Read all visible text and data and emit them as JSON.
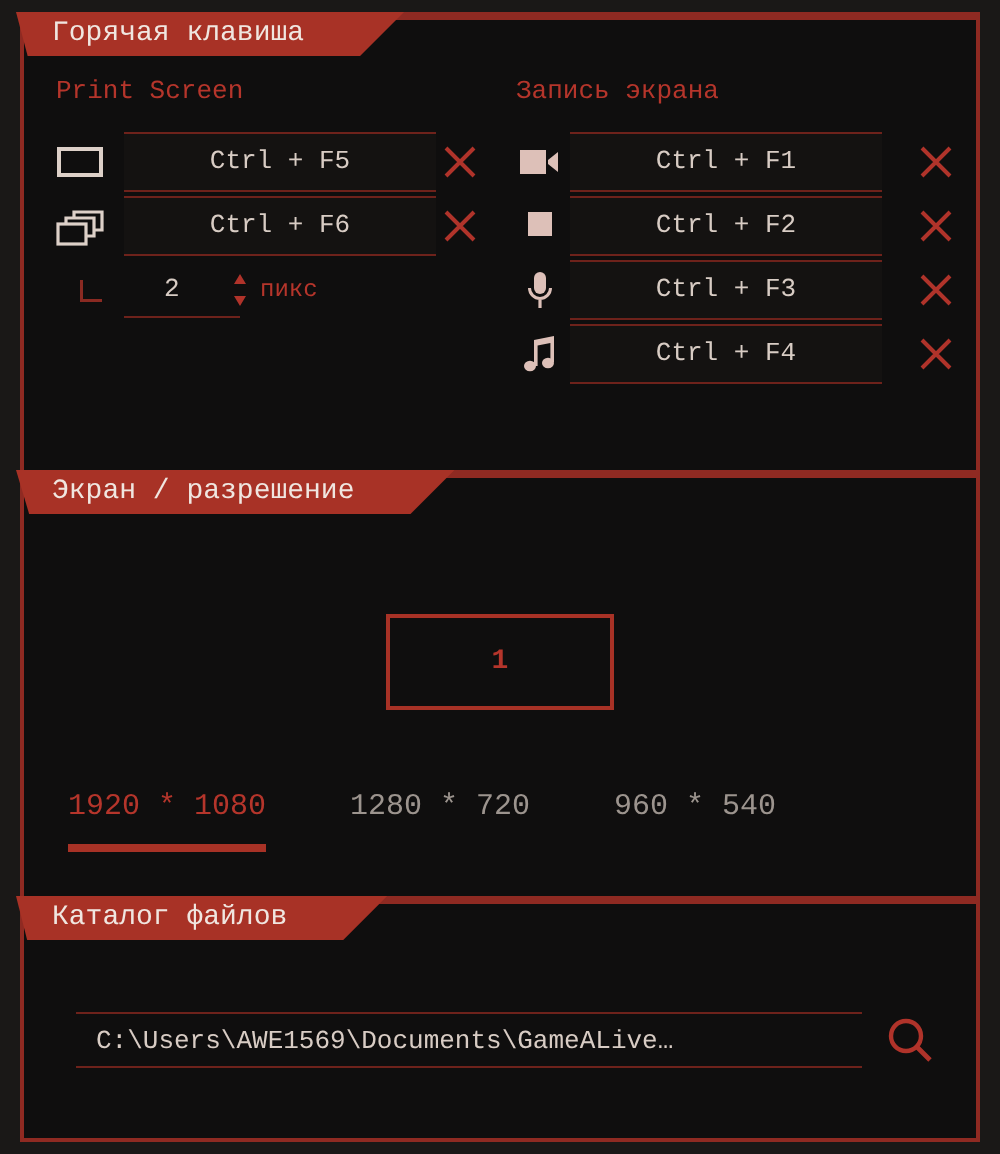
{
  "hotkeys": {
    "title": "Горячая клавиша",
    "print_screen": {
      "title": "Print Screen",
      "items": [
        {
          "kind": "screen",
          "key": "Ctrl + F5"
        },
        {
          "kind": "window",
          "key": "Ctrl + F6"
        }
      ],
      "interval": {
        "value": "2",
        "unit": "пикс"
      }
    },
    "recording": {
      "title": "Запись экрана",
      "items": [
        {
          "kind": "video",
          "key": "Ctrl + F1"
        },
        {
          "kind": "stop",
          "key": "Ctrl + F2"
        },
        {
          "kind": "mic",
          "key": "Ctrl + F3"
        },
        {
          "kind": "music",
          "key": "Ctrl + F4"
        }
      ]
    }
  },
  "resolution": {
    "title": "Экран / разрешение",
    "monitor": "1",
    "options": [
      {
        "label": "1920 * 1080",
        "selected": true
      },
      {
        "label": "1280 * 720",
        "selected": false
      },
      {
        "label": "960 * 540",
        "selected": false
      }
    ]
  },
  "files": {
    "title": "Каталог файлов",
    "path": "C:\\Users\\AWE1569\\Documents\\GameALive…"
  }
}
